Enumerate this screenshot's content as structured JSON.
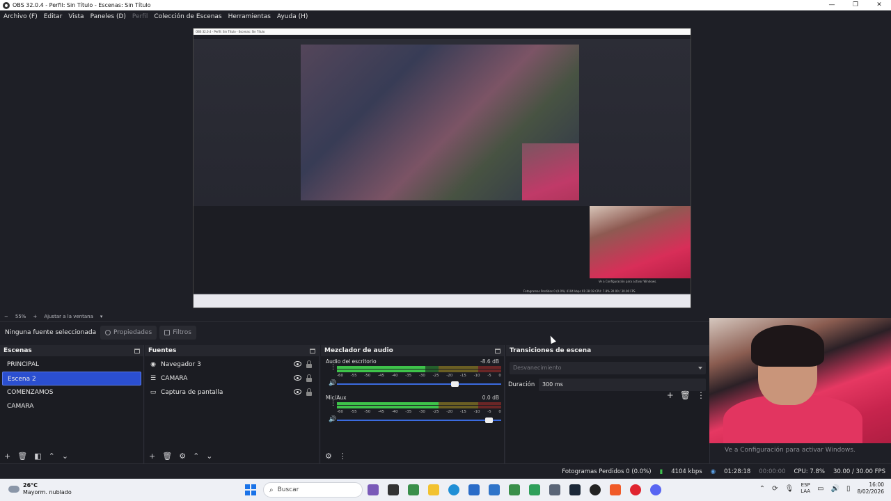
{
  "window": {
    "title": "OBS 32.0.4 - Perfil: Sin Título - Escenas: Sin Título",
    "controls": [
      "—",
      "❐",
      "✕"
    ]
  },
  "menu": {
    "items": [
      {
        "label": "Archivo (F)"
      },
      {
        "label": "Editar"
      },
      {
        "label": "Vista"
      },
      {
        "label": "Paneles (D)"
      },
      {
        "label": "Perfil"
      },
      {
        "label": "Colección de Escenas"
      },
      {
        "label": "Herramientas"
      },
      {
        "label": "Ayuda (H)"
      }
    ]
  },
  "preview": {
    "nested_title": "OBS 32.0.4 - Perfil: Sin Título - Escenas: Sin Título",
    "nested_status": "Fotogramas Perdidos 0 (0.0%)   4104 kbps   01:28:18   CPU: 7.8%   30.00 / 30.00 FPS",
    "nested_activate": "Ve a Configuración para activar Windows."
  },
  "zoom": {
    "minus": "−",
    "value": "55%",
    "plus": "+",
    "fit_label": "Ajustar a la ventana"
  },
  "source_toolbar": {
    "no_selection": "Ninguna fuente seleccionada",
    "properties": "Propiedades",
    "filters": "Filtros"
  },
  "scenes": {
    "title": "Escenas",
    "items": [
      {
        "label": "PRINCIPAL"
      },
      {
        "label": "Escena 2"
      },
      {
        "label": "COMENZAMOS"
      },
      {
        "label": "CAMARA"
      }
    ],
    "selected_index": 1
  },
  "sources": {
    "title": "Fuentes",
    "items": [
      {
        "label": "Navegador 3",
        "icon": "browser-icon"
      },
      {
        "label": "CAMARA",
        "icon": "list-icon"
      },
      {
        "label": "Captura de pantalla",
        "icon": "monitor-icon"
      }
    ]
  },
  "mixer": {
    "title": "Mezclador de audio",
    "scale": [
      "-60",
      "-55",
      "-50",
      "-45",
      "-40",
      "-35",
      "-30",
      "-25",
      "-20",
      "-15",
      "-10",
      "-5",
      "0"
    ],
    "channels": [
      {
        "name": "Audio del escritorio",
        "db": "-8.6 dB",
        "level": 0.54,
        "volume": 0.72
      },
      {
        "name": "Mic/Aux",
        "db": "0.0 dB",
        "level": 0.62,
        "volume": 0.93
      }
    ]
  },
  "transitions": {
    "title": "Transiciones de escena",
    "selected": "Desvanecimiento",
    "duration_label": "Duración",
    "duration_value": "300 ms"
  },
  "activate_windows": "Ve a Configuración para activar Windows.",
  "status": {
    "dropped": "Fotogramas Perdidos 0 (0.0%)",
    "bitrate": "4104 kbps",
    "stream_time": "01:28:18",
    "rec_time": "00:00:00",
    "cpu": "CPU: 7.8%",
    "fps": "30.00 / 30.00 FPS"
  },
  "taskbar": {
    "temp": "26°C",
    "weather": "Mayorm. nublado",
    "search": "Buscar",
    "lang1": "ESP",
    "lang2": "LAA",
    "time": "16:00",
    "date": "8/02/2026"
  },
  "colors": {
    "accent": "#2b4fd0",
    "meter_green": "#3ec24a",
    "meter_yellow": "#d8c23a",
    "meter_red": "#d13a3a"
  }
}
